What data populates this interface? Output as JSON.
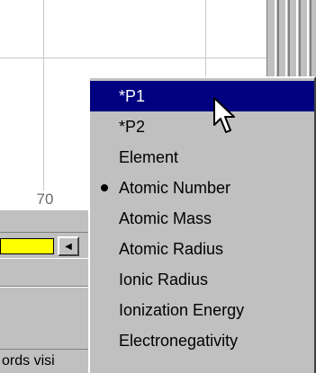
{
  "plot": {
    "tick_label": "70"
  },
  "slider": {
    "fill_fraction": 0.68,
    "button_icon": "scroll-right-icon",
    "button_glyph": "◀"
  },
  "status_bar": {
    "text": "ords visi"
  },
  "menu": {
    "items": [
      {
        "label": "*P1",
        "selected": true,
        "checked": false
      },
      {
        "label": "*P2",
        "selected": false,
        "checked": false
      },
      {
        "label": "Element",
        "selected": false,
        "checked": false
      },
      {
        "label": "Atomic Number",
        "selected": false,
        "checked": true
      },
      {
        "label": "Atomic Mass",
        "selected": false,
        "checked": false
      },
      {
        "label": "Atomic Radius",
        "selected": false,
        "checked": false
      },
      {
        "label": "Ionic Radius",
        "selected": false,
        "checked": false
      },
      {
        "label": "Ionization Energy",
        "selected": false,
        "checked": false
      },
      {
        "label": "Electronegativity",
        "selected": false,
        "checked": false
      }
    ]
  },
  "colors": {
    "highlight": "#000080",
    "slider_fill": "#ffff00",
    "face": "#c0c0c0"
  }
}
